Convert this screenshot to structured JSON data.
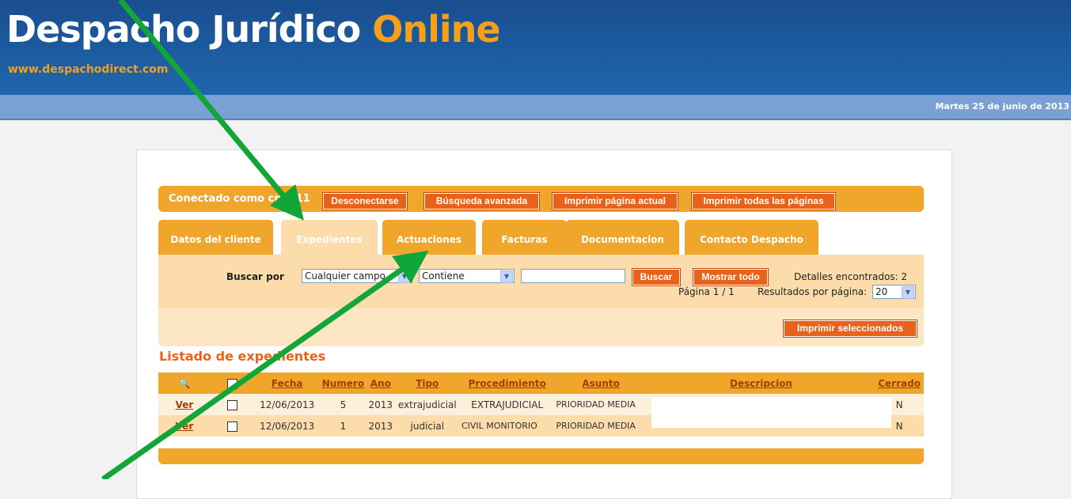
{
  "header": {
    "logo_main": "Despacho Jurídico ",
    "logo_online": "Online",
    "url": "www.despachodirect.com",
    "date": "Martes 25 de junio de 2013"
  },
  "toolbar": {
    "connected": "Conectado como cp5111",
    "logout": "Desconectarse",
    "advanced_search": "Búsqueda avanzada",
    "print_page": "Imprimir página actual",
    "print_all": "Imprimir todas las páginas"
  },
  "tabs": [
    "Datos del cliente",
    "Expedientes",
    "Actuaciones",
    "Facturas",
    "Documentacion",
    "Contacto Despacho"
  ],
  "search": {
    "label": "Buscar por",
    "field": "Cualquier campo",
    "operator": "Contiene",
    "query": "",
    "search_btn": "Buscar",
    "show_all_btn": "Mostrar todo",
    "found": "Detalles encontrados: 2",
    "page": "Página 1 / 1",
    "per_page_label": "Resultados por página:",
    "per_page": "20",
    "print_selected": "Imprimir seleccionados"
  },
  "list": {
    "title": "Listado de expedientes",
    "headers": [
      "Fecha",
      "Numero",
      "Ano",
      "Tipo",
      "Procedimiento",
      "Asunto",
      "Descripcion",
      "Cerrado"
    ],
    "rows": [
      {
        "ver": "Ver",
        "fecha": "12/06/2013",
        "numero": "5",
        "ano": "2013",
        "tipo": "extrajudicial",
        "proc": "EXTRAJUDICIAL",
        "asunto": "PRIORIDAD MEDIA",
        "desc": "",
        "cerrado": "N"
      },
      {
        "ver": "Ver",
        "fecha": "12/06/2013",
        "numero": "1",
        "ano": "2013",
        "tipo": "judicial",
        "proc": "CIVIL MONITORIO",
        "asunto": "PRIORIDAD MEDIA",
        "desc": "",
        "cerrado": "N"
      }
    ]
  },
  "colors": {
    "orange": "#f0a62b",
    "button": "#e8621b",
    "arrow": "#12a537"
  }
}
